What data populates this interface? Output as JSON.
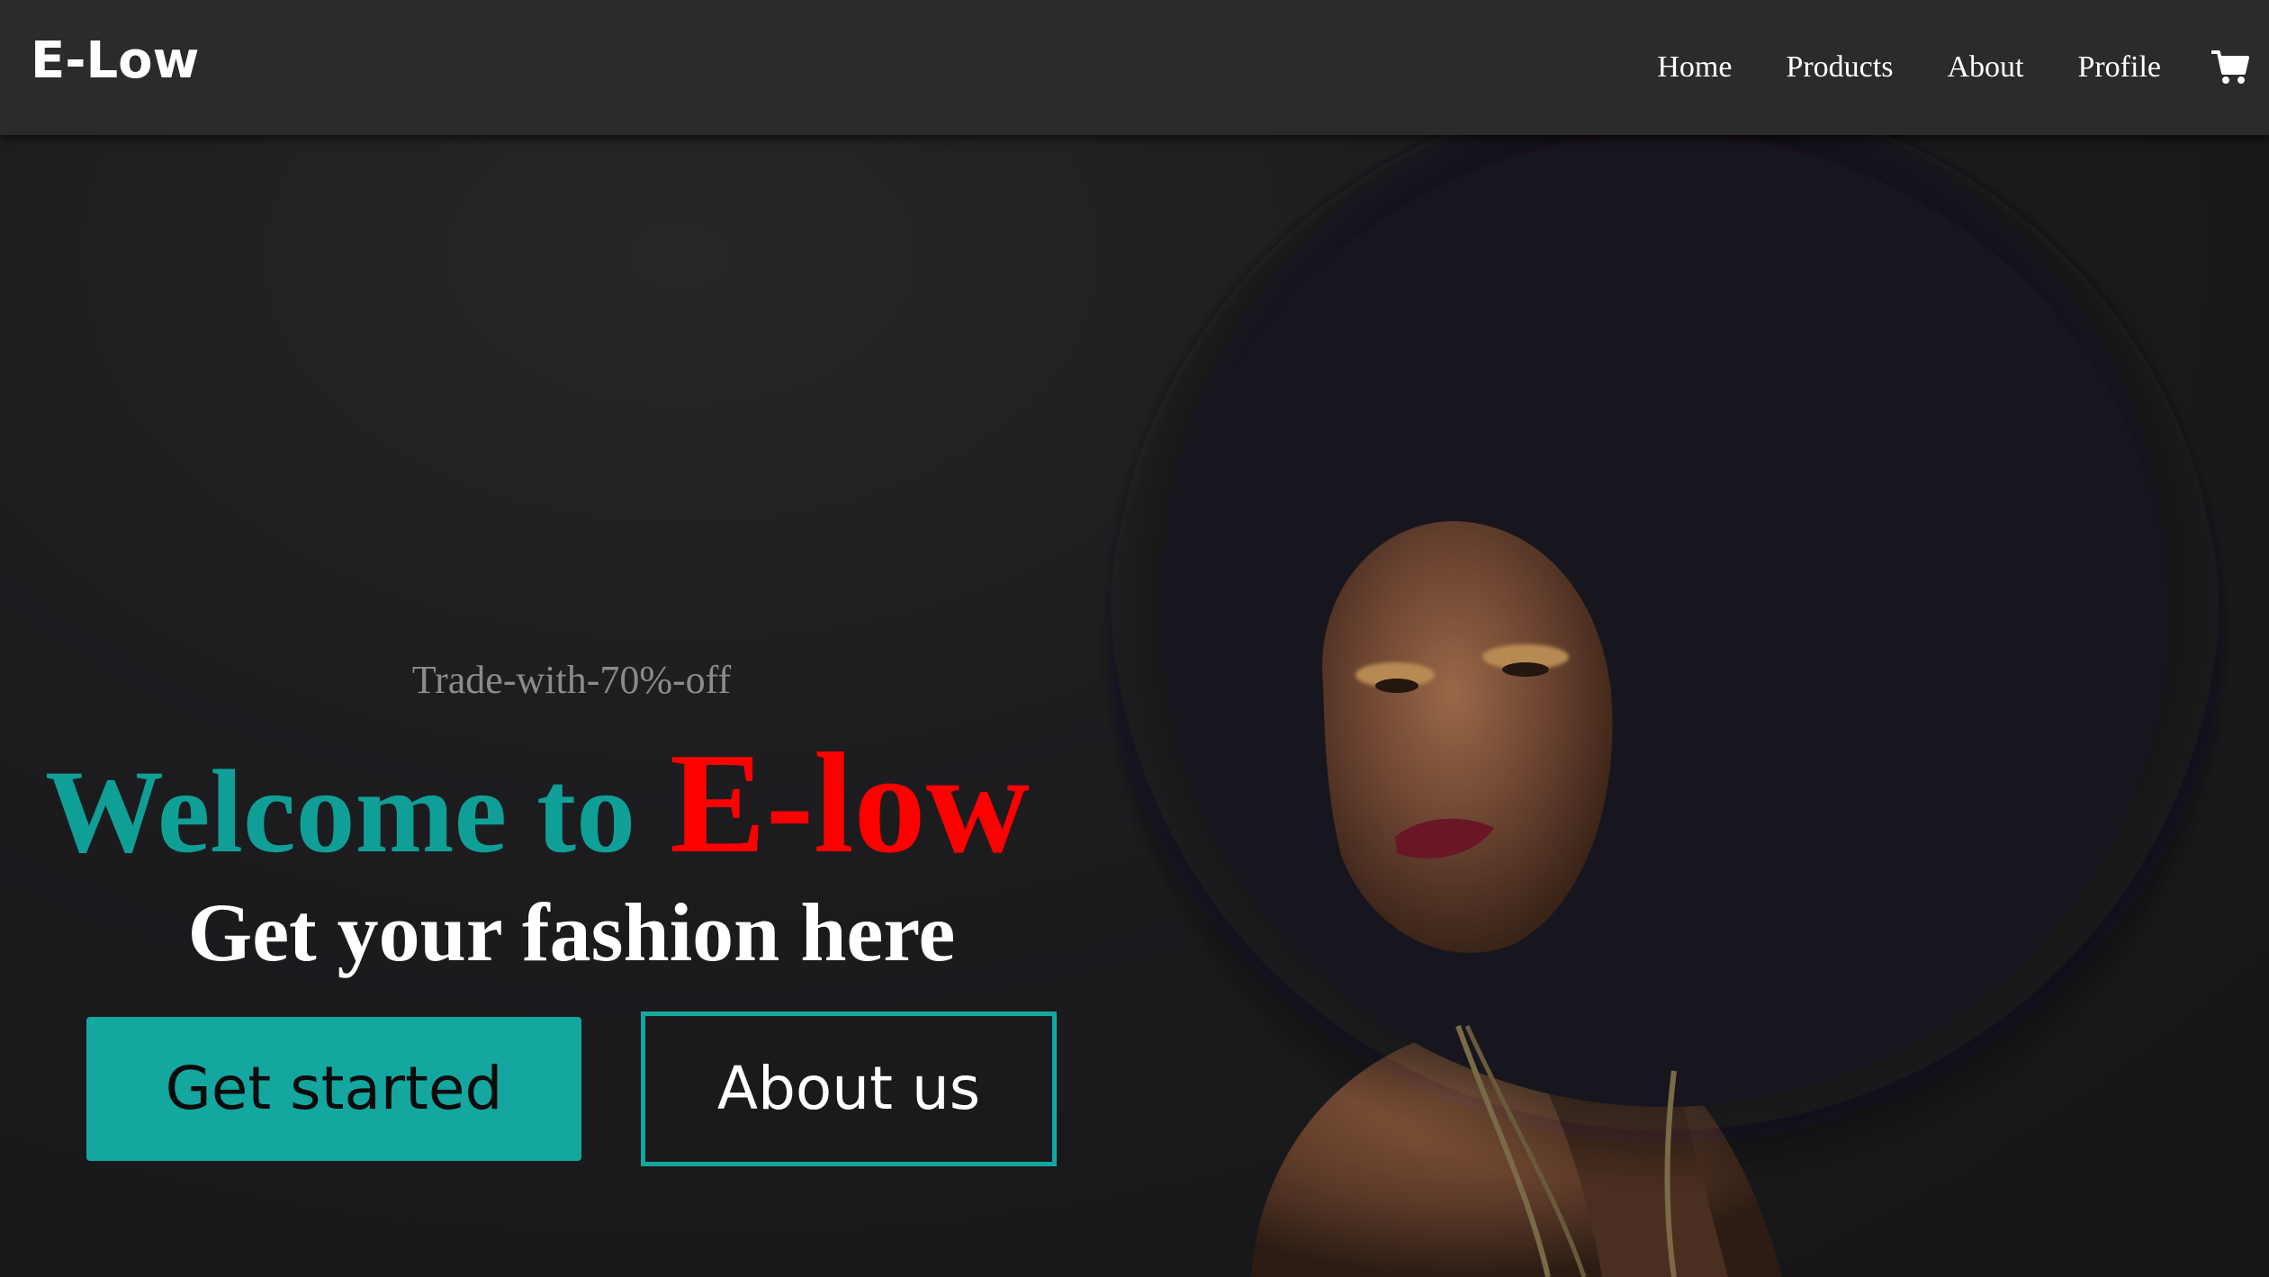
{
  "nav": {
    "brand": "E-Low",
    "links": [
      "Home",
      "Products",
      "About",
      "Profile"
    ],
    "cart_icon": "shopping-cart-icon"
  },
  "hero": {
    "tagline": "Trade-with-70%-off",
    "headline_part1": "Welcome to",
    "headline_part2": "E-low",
    "subheadline": "Get your fashion here",
    "primary_button": "Get started",
    "secondary_button": "About us",
    "image": "woman-with-afro-hair-photo"
  },
  "colors": {
    "accent": "#14a79f",
    "brand_highlight": "#ff0000",
    "navbar": "#2b2b2b",
    "background": "#1a1a1c"
  }
}
